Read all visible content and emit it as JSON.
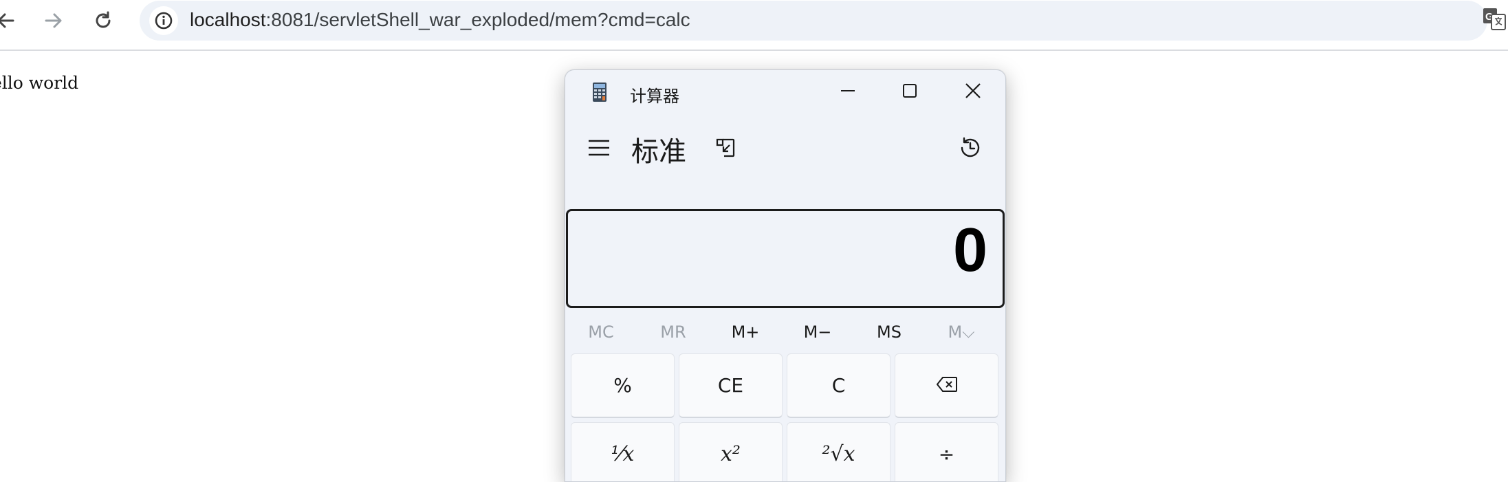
{
  "browser": {
    "url_host": "localhost",
    "url_rest": ":8081/servletShell_war_exploded/mem?cmd=calc",
    "icons": {
      "back": "arrow-left-icon",
      "forward": "arrow-right-icon",
      "reload": "reload-icon",
      "site_info": "info-icon",
      "translate": "translate-icon"
    }
  },
  "page": {
    "body_text": "ello world"
  },
  "calculator": {
    "window_title": "计算器",
    "mode_title": "标准",
    "display_value": "0",
    "memory_buttons": [
      {
        "label": "MC",
        "enabled": false
      },
      {
        "label": "MR",
        "enabled": false
      },
      {
        "label": "M+",
        "enabled": true
      },
      {
        "label": "M−",
        "enabled": true
      },
      {
        "label": "MS",
        "enabled": true
      },
      {
        "label": "M⌵",
        "enabled": false
      }
    ],
    "keys": {
      "percent": "%",
      "clear_entry": "CE",
      "clear": "C",
      "reciprocal": "⅟x",
      "square": "x²",
      "sqrt": "²√x",
      "divide": "÷"
    },
    "colors": {
      "window_bg": "#f0f3f9",
      "key_bg": "#f9fafc",
      "display_border": "#1b1b1b",
      "disabled_text": "#9aa0a8"
    }
  }
}
